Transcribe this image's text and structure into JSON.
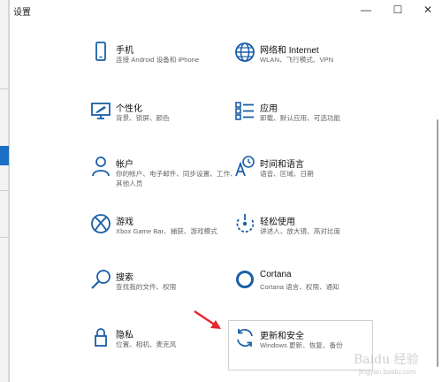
{
  "window": {
    "title": "设置",
    "min_glyph": "—",
    "max_glyph": "☐",
    "close_glyph": "✕"
  },
  "tiles": [
    {
      "id": "phone",
      "name": "手机",
      "desc": "连接 Android 设备和 iPhone",
      "icon": "phone-icon"
    },
    {
      "id": "network",
      "name": "网络和 Internet",
      "desc": "WLAN、飞行模式、VPN",
      "icon": "globe-icon"
    },
    {
      "id": "personalization",
      "name": "个性化",
      "desc": "背景、锁屏、颜色",
      "icon": "paint-monitor-icon"
    },
    {
      "id": "apps",
      "name": "应用",
      "desc": "卸载、默认应用、可选功能",
      "icon": "apps-list-icon"
    },
    {
      "id": "accounts",
      "name": "帐户",
      "desc": "你的帐户、电子邮件、同步设置、工作、其他人员",
      "icon": "person-icon"
    },
    {
      "id": "time-language",
      "name": "时间和语言",
      "desc": "语音、区域、日期",
      "icon": "language-icon"
    },
    {
      "id": "gaming",
      "name": "游戏",
      "desc": "Xbox Game Bar、捕获、游戏模式",
      "icon": "xbox-icon"
    },
    {
      "id": "ease-of-access",
      "name": "轻松使用",
      "desc": "讲述人、放大镜、高对比度",
      "icon": "ease-of-access-icon"
    },
    {
      "id": "search",
      "name": "搜索",
      "desc": "查找我的文件、权限",
      "icon": "magnifier-icon"
    },
    {
      "id": "cortana",
      "name": "Cortana",
      "desc": "Cortana 语言、权限、通知",
      "icon": "cortana-ring-icon"
    },
    {
      "id": "privacy",
      "name": "隐私",
      "desc": "位置、相机、麦克风",
      "icon": "lock-icon"
    },
    {
      "id": "update-security",
      "name": "更新和安全",
      "desc": "Windows 更新、恢复、备份",
      "icon": "sync-arrows-icon"
    }
  ],
  "watermark": {
    "text": "Baidu 经验",
    "url": "jingyan.baidu.com"
  },
  "colors": {
    "accent": "#1a5fa8",
    "annotation_arrow": "#e8262b"
  }
}
